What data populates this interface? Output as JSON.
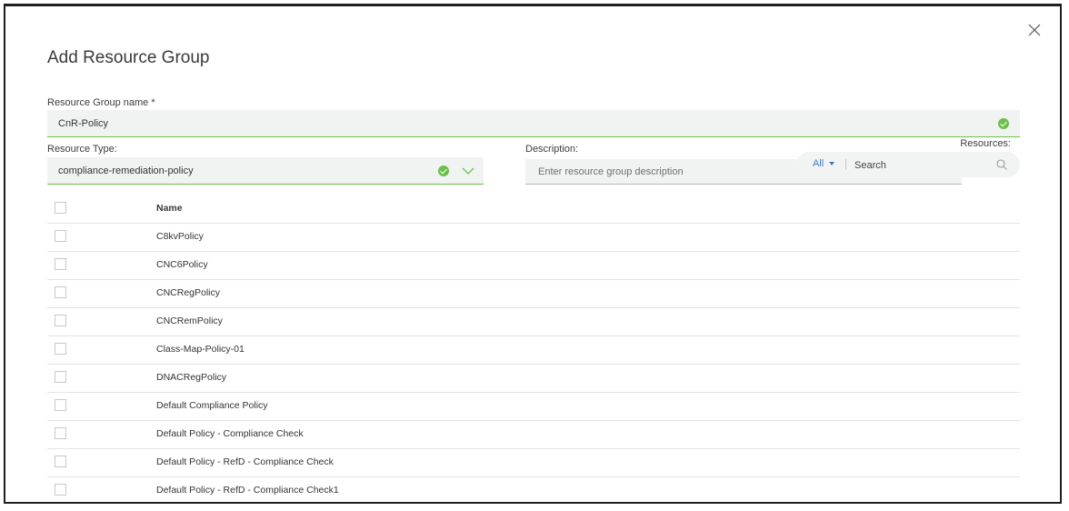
{
  "dialog": {
    "title": "Add Resource Group"
  },
  "form": {
    "group_name_label": "Resource Group name *",
    "group_name_value": "CnR-Policy",
    "resource_type_label": "Resource Type:",
    "resource_type_value": "compliance-remediation-policy",
    "description_label": "Description:",
    "description_placeholder": "Enter resource group description",
    "resources_label": "Resources:"
  },
  "search": {
    "filter_value": "All",
    "placeholder": "Search"
  },
  "table": {
    "header": "Name",
    "rows": [
      "C8kvPolicy",
      "CNC6Policy",
      "CNCRegPolicy",
      "CNCRemPolicy",
      "Class-Map-Policy-01",
      "DNACRegPolicy",
      "Default Compliance Policy",
      "Default Policy - Compliance Check",
      "Default Policy - RefD - Compliance Check",
      "Default Policy - RefD - Compliance Check1"
    ]
  },
  "colors": {
    "valid_green": "#6cc04a",
    "link_blue": "#3a7cc9"
  },
  "icons": [
    "close-icon",
    "check-circle-icon",
    "chevron-down-icon",
    "caret-down-icon",
    "search-icon"
  ]
}
